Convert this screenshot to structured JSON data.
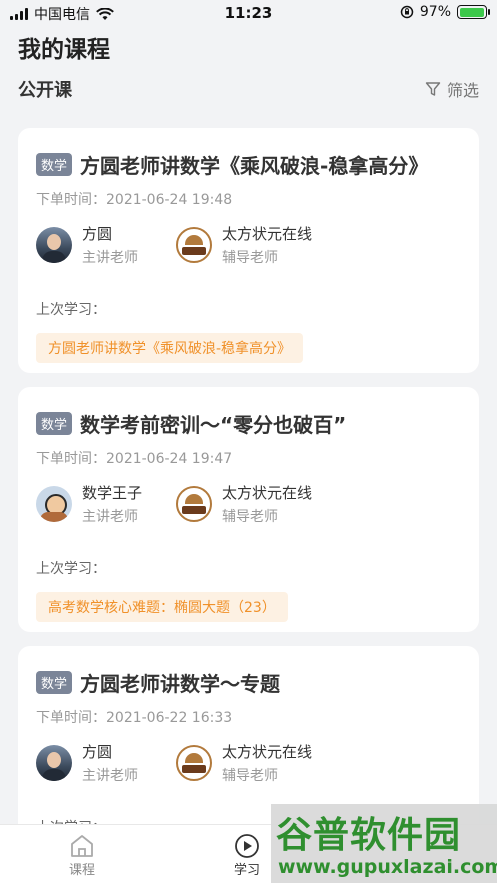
{
  "status_bar": {
    "carrier": "中国电信",
    "time": "11:23",
    "battery_percent": "97%",
    "battery_level": 0.97,
    "battery_color": "#3cc84a"
  },
  "header": {
    "title": "我的课程",
    "section": "公开课",
    "filter_label": "筛选"
  },
  "courses": [
    {
      "subject": "数学",
      "title": "方圆老师讲数学《乘风破浪-稳拿高分》",
      "order_time": "下单时间：2021-06-24 19:48",
      "teachers": [
        {
          "name": "方圆",
          "role": "主讲老师",
          "avatar": "teacher-photo"
        },
        {
          "name": "太方状元在线",
          "role": "辅导老师",
          "avatar": "brand-logo"
        }
      ],
      "last_study_label": "上次学习：",
      "last_study": "方圆老师讲数学《乘风破浪-稳拿高分》"
    },
    {
      "subject": "数学",
      "title": "数学考前密训～“零分也破百”",
      "order_time": "下单时间：2021-06-24 19:47",
      "teachers": [
        {
          "name": "数学王子",
          "role": "主讲老师",
          "avatar": "cartoon-avatar"
        },
        {
          "name": "太方状元在线",
          "role": "辅导老师",
          "avatar": "brand-logo"
        }
      ],
      "last_study_label": "上次学习：",
      "last_study": "高考数学核心难题：椭圆大题（23）"
    },
    {
      "subject": "数学",
      "title": "方圆老师讲数学～专题",
      "order_time": "下单时间：2021-06-22 16:33",
      "teachers": [
        {
          "name": "方圆",
          "role": "主讲老师",
          "avatar": "teacher-photo"
        },
        {
          "name": "太方状元在线",
          "role": "辅导老师",
          "avatar": "brand-logo"
        }
      ],
      "last_study_label": "上次学习：",
      "last_study": ""
    }
  ],
  "tabbar": {
    "course_label": "课程",
    "study_label": "学习"
  },
  "watermark": {
    "cn": "谷普软件园",
    "url": "www.gupuxlazai.com"
  },
  "colors": {
    "accent_orange": "#f0912a",
    "pill_bg": "#fdf1e3",
    "badge_bg": "#7b8598",
    "watermark_green": "#2f8f2f"
  }
}
